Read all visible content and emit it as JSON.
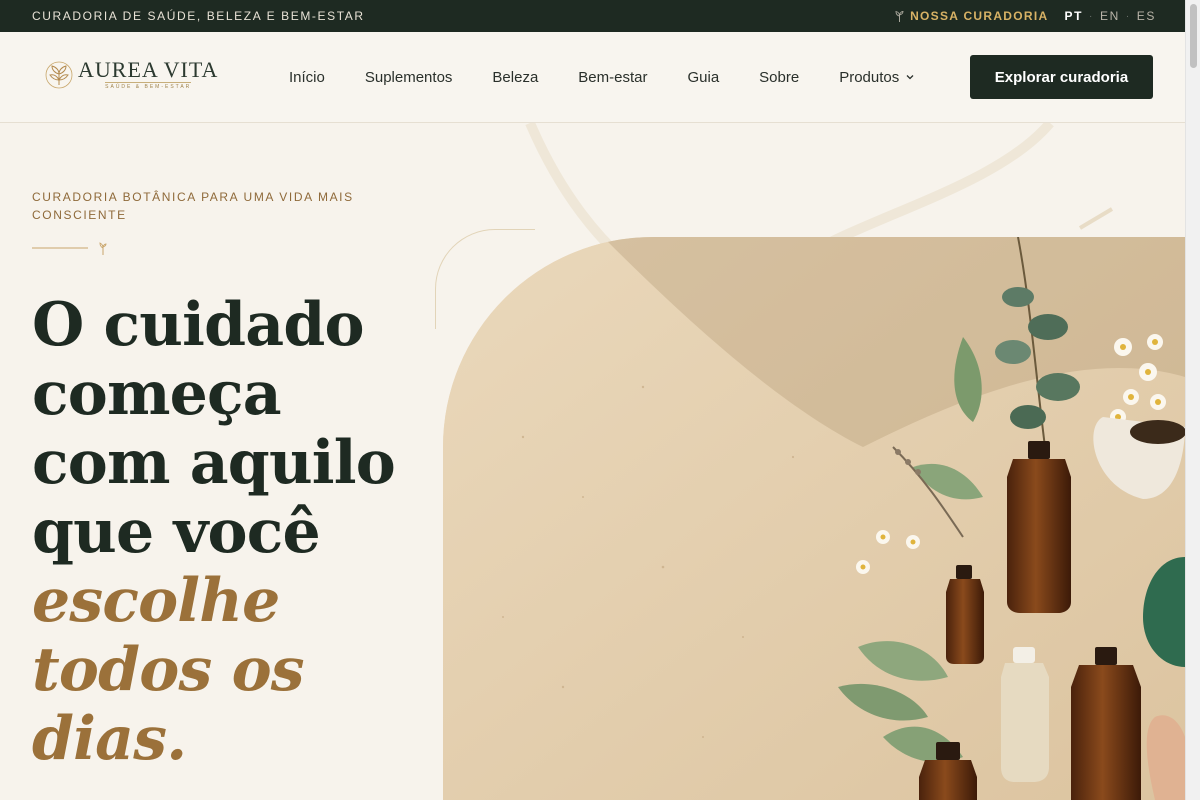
{
  "topbar": {
    "tagline": "CURADORIA DE SAÚDE, BELEZA E BEM-ESTAR",
    "curation_link": "NOSSA CURADORIA",
    "languages": [
      "PT",
      "EN",
      "ES"
    ],
    "active_language": "PT"
  },
  "brand": {
    "name": "AUREA VITA",
    "subtitle": "SAÚDE & BEM-ESTAR"
  },
  "nav": {
    "items": [
      "Início",
      "Suplementos",
      "Beleza",
      "Bem-estar",
      "Guia",
      "Sobre",
      "Produtos"
    ],
    "cta_label": "Explorar curadoria"
  },
  "hero": {
    "eyebrow": "CURADORIA BOTÂNICA PARA UMA VIDA MAIS CONSCIENTE",
    "headline_lines": [
      "O cuidado",
      "começa",
      "com aquilo",
      "que você"
    ],
    "headline_accent_lines": [
      "escolhe",
      "todos os",
      "dias."
    ]
  },
  "colors": {
    "dark_green": "#1e2a22",
    "gold": "#d8b265",
    "accent_brown": "#9b713a",
    "cream_bg": "#f7f3ec"
  },
  "icons": [
    "sprout-icon",
    "chevron-down-icon",
    "logo-leaf-icon"
  ]
}
